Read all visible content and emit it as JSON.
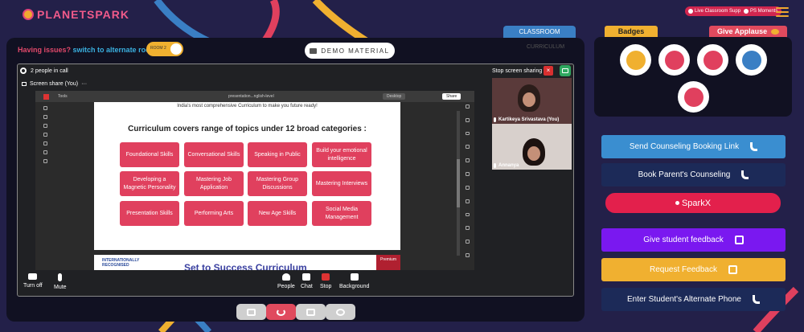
{
  "brand": {
    "logo_text": "PLANETSPARK"
  },
  "top_links": {
    "live_support": "Live Classroom Support",
    "ps_moments": "PS Moments"
  },
  "issue_bar": {
    "text": "Having issues?",
    "link": "switch to alternate room",
    "toggle_label": "ROOM 2"
  },
  "demo_button": "DEMO MATERIAL",
  "tabs": {
    "classroom": "CLASSROOM",
    "curriculum": "CURRICULUM"
  },
  "call": {
    "people_count": "2 people in call",
    "stop_sharing": "Stop screen sharing",
    "screen_share_label": "Screen share (You)",
    "browser": {
      "tab": "Tools",
      "doc_title": "presentation...nglish-level",
      "desktop": "Desktop",
      "share": "Share"
    }
  },
  "slide": {
    "subtitle": "India's most comprehensive Curriculum to make you future ready!",
    "title": "Curriculum covers range of topics under 12 broad categories :",
    "categories": [
      "Foundational Skills",
      "Conversational Skills",
      "Speaking in Public",
      "Build your emotional intelligence",
      "Developing a Magnetic Personality",
      "Mastering Job Application",
      "Mastering Group Discussions",
      "Mastering Interviews",
      "Presentation Skills",
      "Performing Arts",
      "New Age Skills",
      "Social Media Management"
    ],
    "next_badge": "INTERNATIONALLY RECOGNISED",
    "next_title": "Set to Success Curriculum",
    "next_premium": "Premium"
  },
  "participants": [
    {
      "name": "Kartikeya Srivastava (You)"
    },
    {
      "name": "Annanya"
    }
  ],
  "controls": {
    "turn_off": "Turn off",
    "mute": "Mute",
    "people": "People",
    "chat": "Chat",
    "stop": "Stop",
    "background": "Background"
  },
  "right_panel": {
    "badges_tab": "Badges",
    "applause_tab": "Give Applause",
    "buttons": {
      "send_counseling": "Send Counseling Booking Link",
      "book_parent": "Book Parent's Counseling",
      "sparkx": "SparkX",
      "give_feedback": "Give student feedback",
      "request_feedback": "Request Feedback",
      "alternate_phone": "Enter Student's Alternate Phone"
    }
  },
  "colors": {
    "background": "#232049",
    "accent_red": "#e0405e",
    "accent_yellow": "#f0b030",
    "accent_blue": "#3a7fc4",
    "accent_purple": "#7a18f0"
  }
}
